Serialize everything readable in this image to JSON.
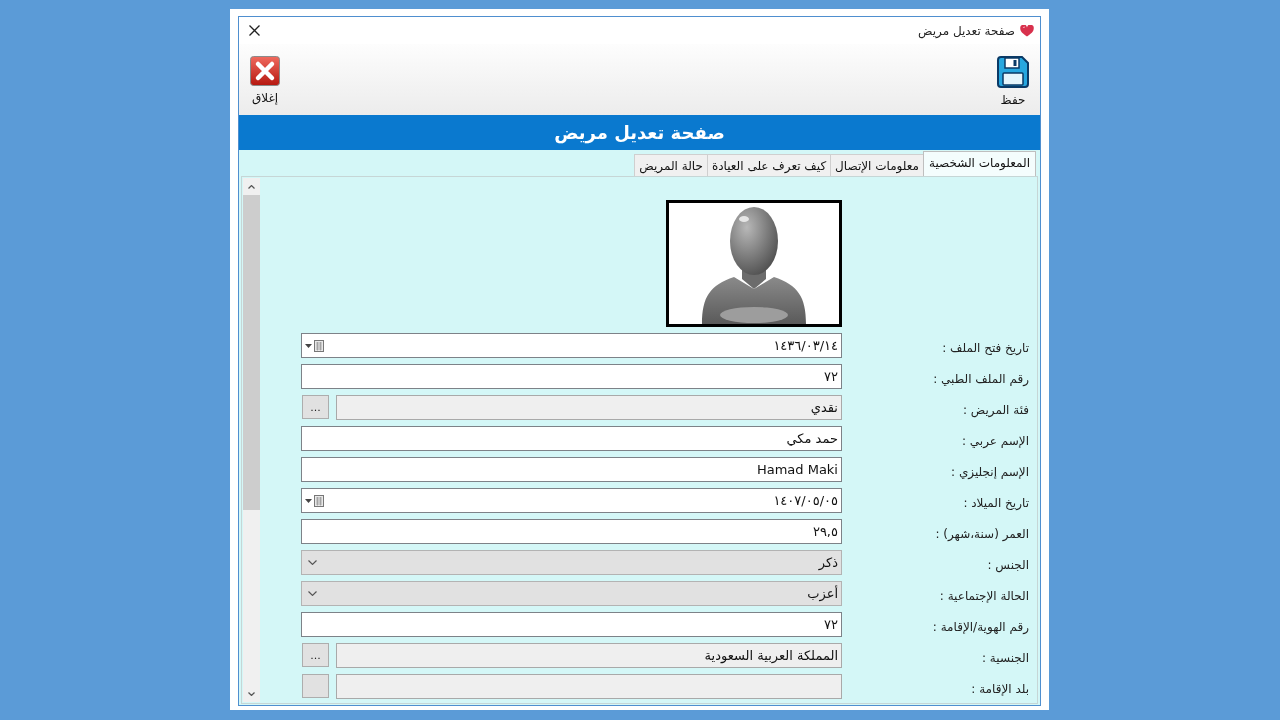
{
  "window": {
    "title": "صفحة تعديل مريض"
  },
  "toolbar": [
    {
      "kind": "save",
      "label": "حفظ"
    },
    {
      "kind": "close",
      "label": "إغلاق"
    }
  ],
  "header": {
    "title": "صفحة تعديل مريض"
  },
  "tabs": [
    {
      "label": "المعلومات الشخصية",
      "selected": true
    },
    {
      "label": "معلومات الإتصال",
      "selected": false
    },
    {
      "label": "كيف تعرف على العيادة",
      "selected": false
    },
    {
      "label": "حالة المريض",
      "selected": false
    }
  ],
  "form": {
    "fields": [
      {
        "label": "تاريخ فتح الملف :",
        "kind": "date",
        "value": "١٤٣٦/٠٣/١٤"
      },
      {
        "label": "رقم الملف الطبي :",
        "kind": "text",
        "value": "٧٢"
      },
      {
        "label": "فئة المريض :",
        "kind": "lookup",
        "value": "نقدي",
        "button": "..."
      },
      {
        "label": "الإسم عربي :",
        "kind": "text",
        "value": "حمد مكي"
      },
      {
        "label": "الإسم إنجليزي :",
        "kind": "text",
        "value": "Hamad Maki"
      },
      {
        "label": "تاريخ الميلاد :",
        "kind": "date",
        "value": "١٤٠٧/٠٥/٠٥"
      },
      {
        "label": "العمر (سنة،شهر) :",
        "kind": "text",
        "value": "٢٩,٥"
      },
      {
        "label": "الجنس :",
        "kind": "dropdown",
        "value": "ذكر"
      },
      {
        "label": "الحالة الإجتماعية :",
        "kind": "dropdown",
        "value": "أعزب"
      },
      {
        "label": "رقم الهوية/الإقامة :",
        "kind": "text",
        "value": "٧٢"
      },
      {
        "label": "الجنسية :",
        "kind": "lookup",
        "value": "المملكة العربية السعودية",
        "button": "..."
      },
      {
        "label": "بلد الإقامة :",
        "kind": "lookup"
      }
    ]
  }
}
